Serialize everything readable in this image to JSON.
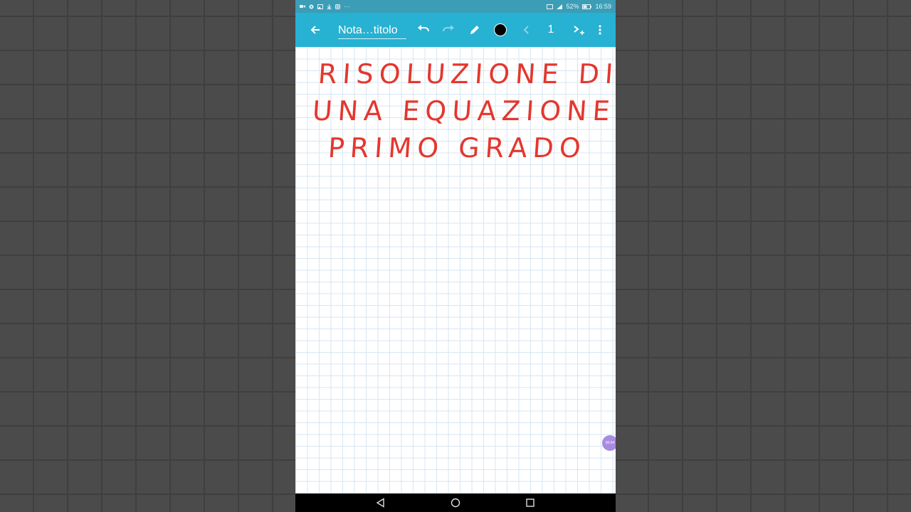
{
  "status_bar": {
    "icons_left": [
      "recording-icon",
      "settings-icon",
      "image-icon",
      "download-icon",
      "instagram-icon"
    ],
    "more": "···",
    "battery": "52%",
    "time": "16:59"
  },
  "toolbar": {
    "title": "Nota…titolo",
    "page_number": "1",
    "pen_color": "#000000",
    "accent_color": "#27b1d2"
  },
  "note": {
    "lines": [
      "RISOLUZIONE DI",
      "UNA EQUAZIONE DI",
      "PRIMO GRADO"
    ],
    "ink_color": "#e4372e"
  },
  "recording_bubble": {
    "time": "00:04"
  }
}
